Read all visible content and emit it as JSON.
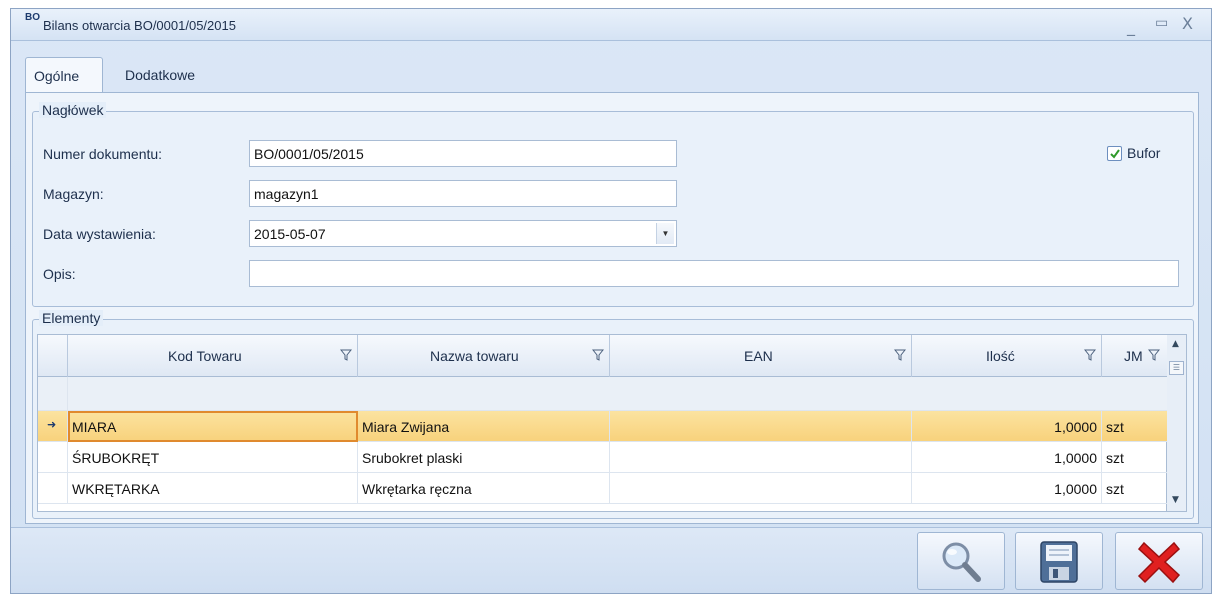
{
  "window": {
    "app_icon_text": "BO",
    "title": "Bilans otwarcia BO/0001/05/2015",
    "minimize_glyph": "_",
    "maximize_glyph": "▭",
    "close_glyph": "X"
  },
  "tabs": [
    {
      "label": "Ogólne",
      "active": true
    },
    {
      "label": "Dodatkowe",
      "active": false
    }
  ],
  "header_group": {
    "legend": "Nagłówek",
    "fields": {
      "numer": {
        "label": "Numer dokumentu:",
        "value": "BO/0001/05/2015"
      },
      "magazyn": {
        "label": "Magazyn:",
        "value": "magazyn1"
      },
      "data": {
        "label": "Data wystawienia:",
        "value": "2015-05-07"
      },
      "opis": {
        "label": "Opis:",
        "value": ""
      }
    },
    "bufor": {
      "label": "Bufor",
      "checked": true
    }
  },
  "elements_group": {
    "legend": "Elementy",
    "columns": [
      "Kod Towaru",
      "Nazwa towaru",
      "EAN",
      "Ilość",
      "JM"
    ],
    "rows": [
      {
        "kod": "MIARA",
        "nazwa": "Miara Zwijana",
        "ean": "",
        "ilosc": "1,0000",
        "jm": "szt",
        "selected": true
      },
      {
        "kod": "ŚRUBOKRĘT",
        "nazwa": "Srubokret plaski",
        "ean": "",
        "ilosc": "1,0000",
        "jm": "szt",
        "selected": false
      },
      {
        "kod": "WKRĘTARKA",
        "nazwa": "Wkrętarka ręczna",
        "ean": "",
        "ilosc": "1,0000",
        "jm": "szt",
        "selected": false
      }
    ],
    "row_indicator_glyph": "➜"
  },
  "buttons": {
    "search_icon": "magnifier-icon",
    "save_icon": "floppy-disk-icon",
    "cancel_icon": "red-x-icon"
  },
  "colors": {
    "selected_row": "#f8d27c",
    "focus_border": "#e08a2e",
    "cancel_red": "#e02020"
  }
}
